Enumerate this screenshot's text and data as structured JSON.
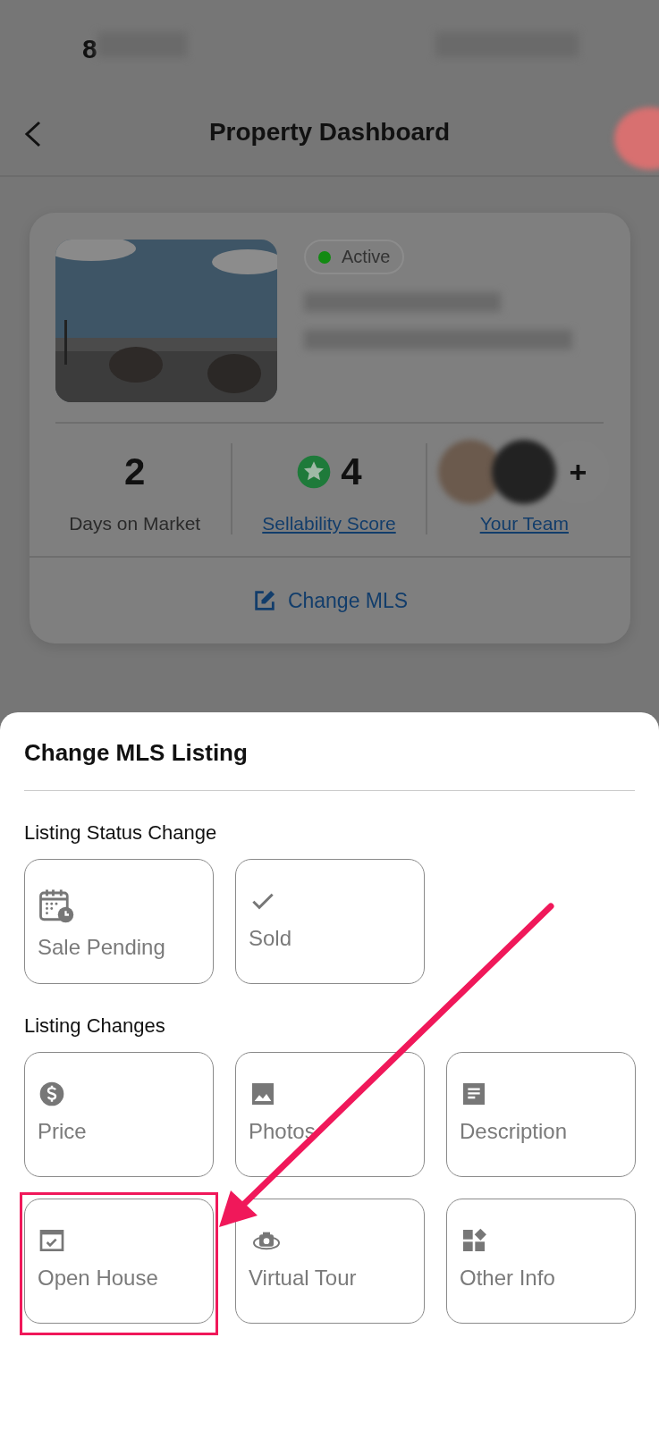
{
  "status_bar": {
    "time": "8"
  },
  "header": {
    "title": "Property Dashboard"
  },
  "listing": {
    "status": "Active",
    "stats": [
      {
        "kind": "number",
        "value": "2",
        "label": "Days on Market",
        "link": false
      },
      {
        "kind": "score",
        "value": "4",
        "label": "Sellability Score",
        "link": true
      },
      {
        "kind": "team",
        "add": "+",
        "label": "Your Team",
        "link": true
      }
    ],
    "action": "Change MLS"
  },
  "sheet": {
    "title": "Change MLS Listing",
    "sections": [
      {
        "heading": "Listing Status Change",
        "options": [
          {
            "kind": "pending",
            "label": "Sale Pending",
            "highlighted": false
          },
          {
            "kind": "sold",
            "label": "Sold",
            "highlighted": false
          }
        ]
      },
      {
        "heading": "Listing Changes",
        "options": [
          {
            "kind": "price",
            "label": "Price",
            "highlighted": false
          },
          {
            "kind": "photos",
            "label": "Photos",
            "highlighted": false
          },
          {
            "kind": "description",
            "label": "Description",
            "highlighted": false
          },
          {
            "kind": "openhouse",
            "label": "Open House",
            "highlighted": true
          },
          {
            "kind": "tour",
            "label": "Virtual Tour",
            "highlighted": false
          },
          {
            "kind": "other",
            "label": "Other Info",
            "highlighted": false
          }
        ]
      }
    ]
  }
}
